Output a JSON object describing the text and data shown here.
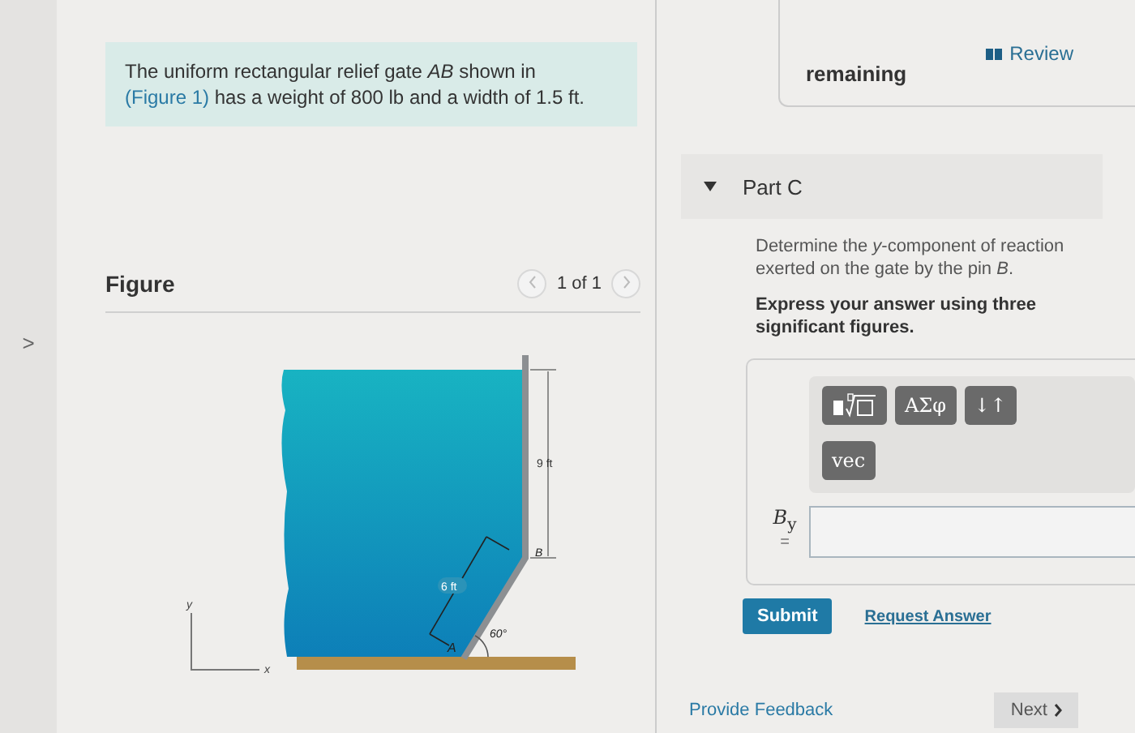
{
  "problem": {
    "text_before": "The uniform rectangular relief gate *AB* shown in",
    "link": "(Figure 1)",
    "text_after": "has a weight of 800 lb and a width of 1.5 ft."
  },
  "figure": {
    "title": "Figure",
    "pager": "1 of 1",
    "labels": {
      "height": "9 ft",
      "length": "6 ft",
      "point_a": "A",
      "point_b": "B",
      "angle": "60°",
      "axis_y": "y",
      "axis_x": "x"
    }
  },
  "side_toggle": ">",
  "review": "Review",
  "remaining": "remaining",
  "part": {
    "title": "Part C",
    "expanded": true,
    "question": "Determine the *y*-component of reaction exerted on the gate by the pin *B*.",
    "instruction": "Express your answer using three significant figures.",
    "toolbar": [
      {
        "kind": "template"
      },
      {
        "kind": "text",
        "label": "ΑΣφ"
      },
      {
        "kind": "text",
        "label": "↓↑"
      },
      {
        "kind": "text",
        "label": "vec"
      }
    ],
    "answer_label": "*B*$_{y}$",
    "equals": "=",
    "submit": "Submit",
    "request": "Request Answer"
  },
  "feedback": "Provide Feedback",
  "next": "Next"
}
